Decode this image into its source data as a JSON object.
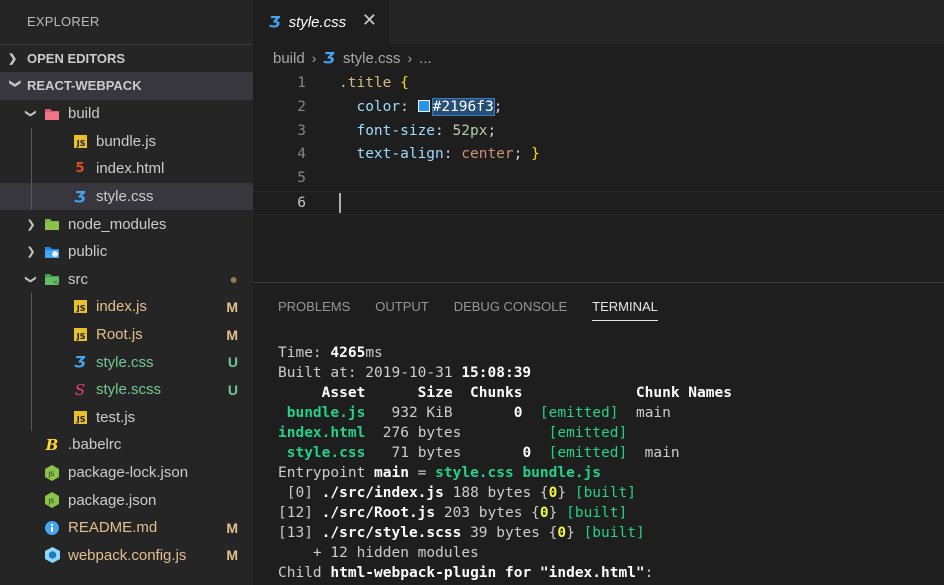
{
  "sidebar": {
    "title": "EXPLORER",
    "open_editors": "OPEN EDITORS",
    "project": "REACT-WEBPACK",
    "items": [
      {
        "label": "build",
        "depth": 1,
        "chevron": "open",
        "icon": "folder-build-icon",
        "color": "#cccccc"
      },
      {
        "label": "bundle.js",
        "depth": 2,
        "icon": "js-file-icon",
        "color": "#cccccc"
      },
      {
        "label": "index.html",
        "depth": 2,
        "icon": "html-file-icon",
        "color": "#cccccc"
      },
      {
        "label": "style.css",
        "depth": 2,
        "icon": "css-file-icon",
        "color": "#cccccc",
        "selected": true
      },
      {
        "label": "node_modules",
        "depth": 1,
        "chevron": "closed",
        "icon": "folder-node-icon",
        "color": "#cccccc"
      },
      {
        "label": "public",
        "depth": 1,
        "chevron": "closed",
        "icon": "folder-public-icon",
        "color": "#cccccc"
      },
      {
        "label": "src",
        "depth": 1,
        "chevron": "open",
        "icon": "folder-src-icon",
        "color": "#cccccc",
        "status": "●",
        "status_color": "#8c7b4f"
      },
      {
        "label": "index.js",
        "depth": 2,
        "icon": "js-file-icon",
        "color": "#e2c08d",
        "status": "M",
        "status_color": "#e2c08d"
      },
      {
        "label": "Root.js",
        "depth": 2,
        "icon": "js-file-icon",
        "color": "#e2c08d",
        "status": "M",
        "status_color": "#e2c08d"
      },
      {
        "label": "style.css",
        "depth": 2,
        "icon": "css-file-icon",
        "color": "#73c991",
        "status": "U",
        "status_color": "#73c991"
      },
      {
        "label": "style.scss",
        "depth": 2,
        "icon": "scss-file-icon",
        "color": "#73c991",
        "status": "U",
        "status_color": "#73c991"
      },
      {
        "label": "test.js",
        "depth": 2,
        "icon": "js-file-icon",
        "color": "#cccccc"
      },
      {
        "label": ".babelrc",
        "depth": 1,
        "icon": "babel-file-icon",
        "color": "#cccccc"
      },
      {
        "label": "package-lock.json",
        "depth": 1,
        "icon": "nodejs-file-icon",
        "color": "#cccccc"
      },
      {
        "label": "package.json",
        "depth": 1,
        "icon": "nodejs-file-icon",
        "color": "#cccccc"
      },
      {
        "label": "README.md",
        "depth": 1,
        "icon": "info-file-icon",
        "color": "#e2c08d",
        "status": "M",
        "status_color": "#e2c08d"
      },
      {
        "label": "webpack.config.js",
        "depth": 1,
        "icon": "webpack-file-icon",
        "color": "#e2c08d",
        "status": "M",
        "status_color": "#e2c08d"
      }
    ]
  },
  "editor": {
    "tab_label": "style.css",
    "tab_close": "✕",
    "breadcrumb": {
      "folder": "build",
      "file": "style.css",
      "tail": "..."
    },
    "lines": [
      {
        "n": "1",
        "selector": ".title",
        "brace": "{"
      },
      {
        "n": "2",
        "prop": "color",
        "hex": "#2196f3",
        "swatch": "#2196f3"
      },
      {
        "n": "3",
        "prop": "font-size",
        "num": "52",
        "unit": "px"
      },
      {
        "n": "4",
        "prop": "text-align",
        "val": "center",
        "close": "}"
      },
      {
        "n": "5"
      },
      {
        "n": "6"
      }
    ]
  },
  "panel": {
    "tabs": [
      "PROBLEMS",
      "OUTPUT",
      "DEBUG CONSOLE",
      "TERMINAL"
    ],
    "active_tab": "TERMINAL",
    "terminal": {
      "time_label": "Time: ",
      "time_value": "4265",
      "time_unit": "ms",
      "built_label": "Built at: 2019-10-31 ",
      "built_time": "15:08:39",
      "header": "     Asset      Size  Chunks             Chunk Names",
      "assets": [
        {
          "name": " bundle.js",
          "size": "   932 KiB",
          "chunk": "       0",
          "emitted": "  [emitted]",
          "names": "  main"
        },
        {
          "name": "index.html",
          "size": "  276 bytes",
          "chunk": "        ",
          "emitted": "  [emitted]",
          "names": ""
        },
        {
          "name": " style.css",
          "size": "   71 bytes",
          "chunk": "       0",
          "emitted": "  [emitted]",
          "names": "  main"
        }
      ],
      "entrypoint": {
        "label": "Entrypoint ",
        "name": "main",
        "eq": " = ",
        "files": "style.css bundle.js"
      },
      "modules": [
        {
          "id": " [0] ",
          "path": "./src/index.js",
          "size": " 188 bytes {",
          "chunk": "0",
          "close": "} ",
          "built": "[built]"
        },
        {
          "id": "[12] ",
          "path": "./src/Root.js",
          "size": " 203 bytes {",
          "chunk": "0",
          "close": "} ",
          "built": "[built]"
        },
        {
          "id": "[13] ",
          "path": "./src/style.scss",
          "size": " 39 bytes {",
          "chunk": "0",
          "close": "} ",
          "built": "[built]"
        }
      ],
      "hidden": "    + 12 hidden modules",
      "child_label": "Child ",
      "child_name": "html-webpack-plugin for \"index.html\"",
      "child_colon": ":"
    }
  }
}
